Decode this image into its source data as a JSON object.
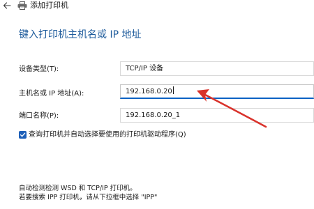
{
  "window": {
    "title": "添加打印机"
  },
  "main": {
    "heading": "键入打印机主机名或 IP 地址"
  },
  "form": {
    "device_type": {
      "label": "设备类型(T):",
      "value": "TCP/IP 设备"
    },
    "hostname": {
      "label": "主机名或 IP 地址(A):",
      "value": "192.168.0.20"
    },
    "port_name": {
      "label": "端口名称(P):",
      "value": "192.168.0.20_1"
    },
    "query_checkbox": {
      "label": "查询打印机并自动选择要使用的打印机驱动程序(Q)",
      "checked": true
    }
  },
  "info": {
    "line1": "自动检测检测 WSD 和 TCP/IP 打印机。",
    "line2": "若要搜索 IPP 打印机，请从下拉框中选择 \"IPP\""
  },
  "colors": {
    "accent": "#0a62c4",
    "heading": "#1f5c9c",
    "annotation_arrow": "#d9322b"
  },
  "icons": {
    "back": "back-arrow-icon",
    "printer": "printer-icon",
    "checkmark": "checkmark-icon"
  }
}
